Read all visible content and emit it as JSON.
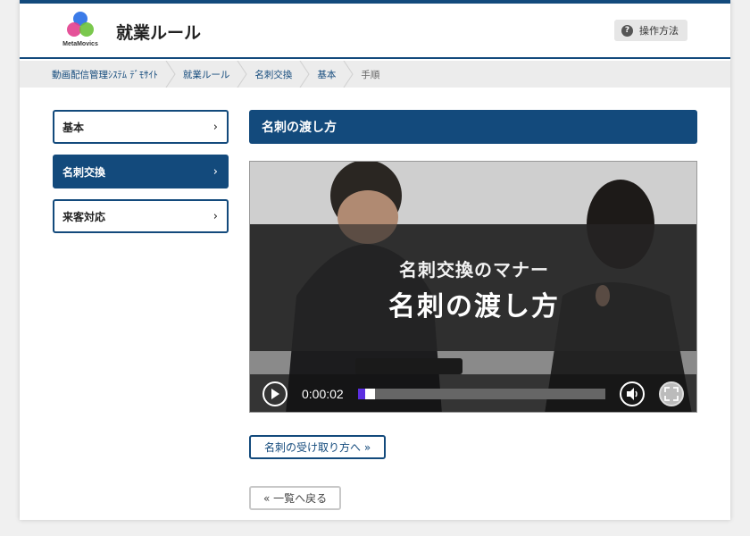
{
  "header": {
    "logo_text": "MetaMovics",
    "title": "就業ルール",
    "help_label": "操作方法"
  },
  "breadcrumb": [
    "動画配信管理ｼｽﾃﾑ ﾃﾞﾓｻｲﾄ",
    "就業ルール",
    "名刺交換",
    "基本",
    "手順"
  ],
  "sidebar": {
    "items": [
      {
        "label": "基本",
        "active": false
      },
      {
        "label": "名刺交換",
        "active": true
      },
      {
        "label": "来客対応",
        "active": false
      }
    ]
  },
  "main": {
    "heading": "名刺の渡し方",
    "video": {
      "overlay_subtitle": "名刺交換のマナー",
      "overlay_title": "名刺の渡し方",
      "time": "0:00:02",
      "progress": 0.03,
      "buffered_end": 0.07
    },
    "next_label": "名刺の受け取り方へ »",
    "back_label": "« 一覧へ戻る"
  },
  "colors": {
    "accent": "#134a7c",
    "progress": "#5b2ee0"
  }
}
